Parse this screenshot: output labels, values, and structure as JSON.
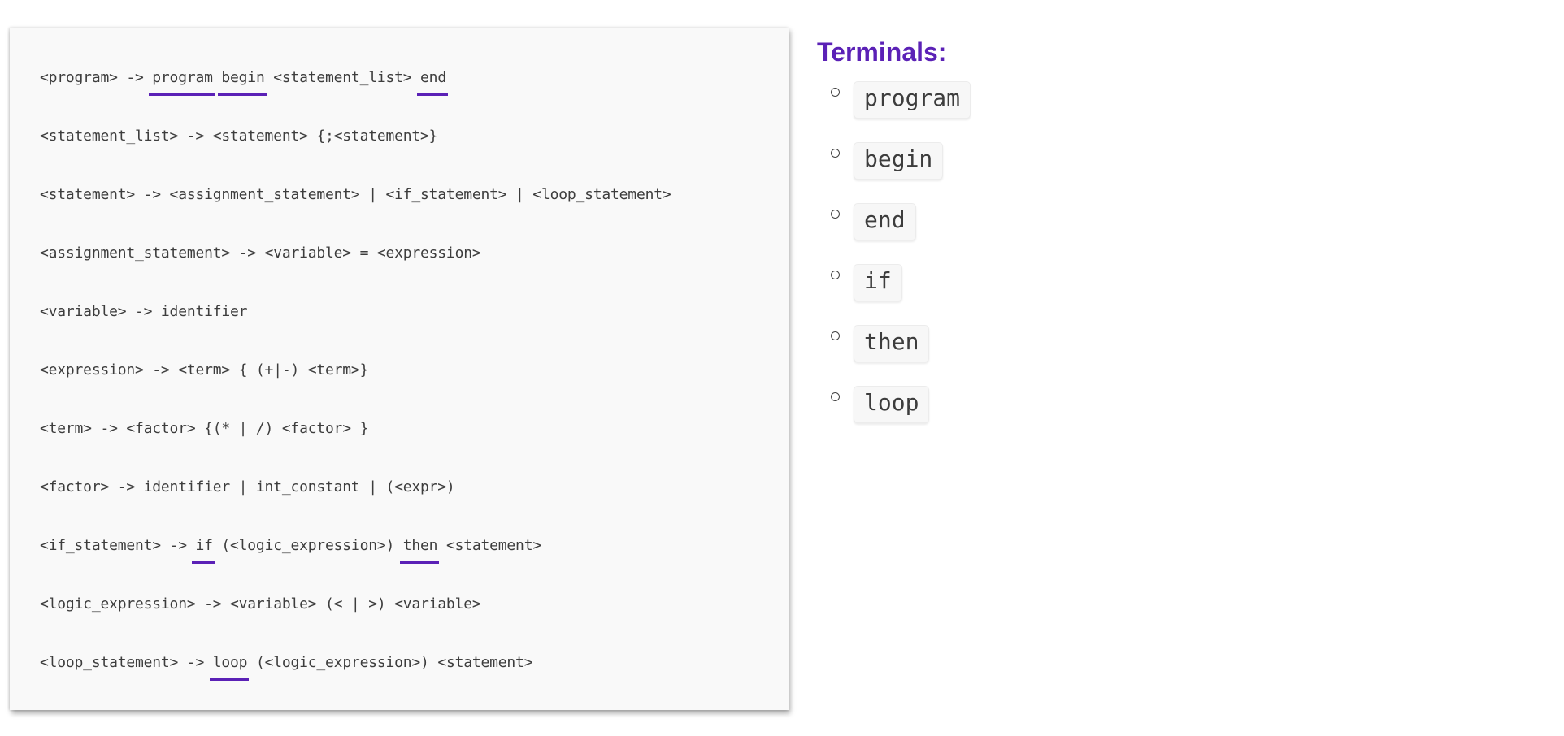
{
  "grammar": {
    "rules": [
      {
        "segments": [
          {
            "text": "<program> -> ",
            "keyword": false
          },
          {
            "text": "program",
            "keyword": true
          },
          {
            "text": " ",
            "keyword": false
          },
          {
            "text": "begin",
            "keyword": true
          },
          {
            "text": " <statement_list> ",
            "keyword": false
          },
          {
            "text": "end",
            "keyword": true
          }
        ]
      },
      {
        "segments": [
          {
            "text": "<statement_list> -> <statement> {;<statement>}",
            "keyword": false
          }
        ]
      },
      {
        "segments": [
          {
            "text": "<statement> -> <assignment_statement> | <if_statement> | <loop_statement>",
            "keyword": false
          }
        ]
      },
      {
        "segments": [
          {
            "text": "<assignment_statement> -> <variable> = <expression>",
            "keyword": false
          }
        ]
      },
      {
        "segments": [
          {
            "text": "<variable> -> identifier",
            "keyword": false
          }
        ]
      },
      {
        "segments": [
          {
            "text": "<expression> -> <term> { (+|-) <term>}",
            "keyword": false
          }
        ]
      },
      {
        "segments": [
          {
            "text": "<term> -> <factor> {(* | /) <factor> }",
            "keyword": false
          }
        ]
      },
      {
        "segments": [
          {
            "text": "<factor> -> identifier | int_constant | (<expr>)",
            "keyword": false
          }
        ]
      },
      {
        "segments": [
          {
            "text": "<if_statement> -> ",
            "keyword": false
          },
          {
            "text": "if",
            "keyword": true
          },
          {
            "text": " (<logic_expression>) ",
            "keyword": false
          },
          {
            "text": "then",
            "keyword": true
          },
          {
            "text": " <statement>",
            "keyword": false
          }
        ]
      },
      {
        "segments": [
          {
            "text": "<logic_expression> -> <variable> (< | >) <variable>",
            "keyword": false
          }
        ]
      },
      {
        "segments": [
          {
            "text": "<loop_statement> -> ",
            "keyword": false
          },
          {
            "text": "loop",
            "keyword": true
          },
          {
            "text": " (<logic_expression>) <statement>",
            "keyword": false
          }
        ]
      }
    ]
  },
  "terminals": {
    "title": "Terminals:",
    "items": [
      "program",
      "begin",
      "end",
      "if",
      "then",
      "loop"
    ]
  },
  "colors": {
    "accent": "#5b21b6",
    "code_text": "#3d3d3d",
    "card_background": "#f9f9f9"
  }
}
